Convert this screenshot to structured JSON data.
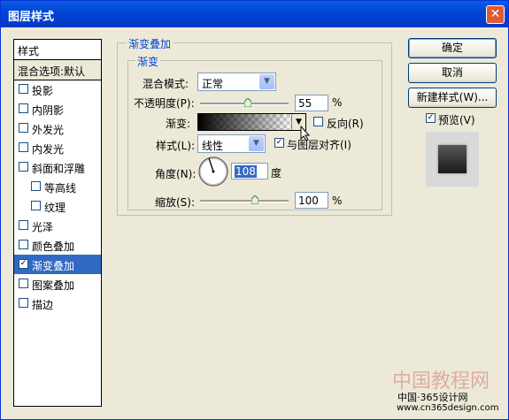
{
  "window": {
    "title": "图层样式",
    "close_glyph": "✕"
  },
  "styles_panel": {
    "header": "样式",
    "blend_options": "混合选项:默认",
    "items": [
      {
        "label": "投影",
        "checked": false
      },
      {
        "label": "内阴影",
        "checked": false
      },
      {
        "label": "外发光",
        "checked": false
      },
      {
        "label": "内发光",
        "checked": false
      },
      {
        "label": "斜面和浮雕",
        "checked": false
      },
      {
        "label": "等高线",
        "checked": false
      },
      {
        "label": "纹理",
        "checked": false
      },
      {
        "label": "光泽",
        "checked": false
      },
      {
        "label": "颜色叠加",
        "checked": false
      },
      {
        "label": "渐变叠加",
        "checked": true,
        "selected": true
      },
      {
        "label": "图案叠加",
        "checked": false
      },
      {
        "label": "描边",
        "checked": false
      }
    ]
  },
  "gradient_overlay": {
    "group_title": "渐变叠加",
    "subgroup_title": "渐变",
    "blend_mode_label": "混合模式:",
    "blend_mode_value": "正常",
    "opacity_label": "不透明度(P):",
    "opacity_value": "55",
    "opacity_unit": "%",
    "gradient_label": "渐变:",
    "reverse_label": "反向(R)",
    "reverse_checked": false,
    "style_label": "样式(L):",
    "style_value": "线性",
    "align_label": "与图层对齐(I)",
    "align_checked": true,
    "angle_label": "角度(N):",
    "angle_value": "108",
    "angle_unit": "度",
    "scale_label": "缩放(S):",
    "scale_value": "100",
    "scale_unit": "%"
  },
  "buttons": {
    "ok": "确定",
    "cancel": "取消",
    "new_style": "新建样式(W)...",
    "preview_label": "预览(V)",
    "preview_checked": true
  },
  "watermark": {
    "line1": "中国教程网",
    "line2": "中国·365设计网",
    "line3": "www.cn365design.com"
  },
  "colors": {
    "accent": "#316ac5",
    "title_bar": "#0145d6",
    "group_title": "#0046d5"
  }
}
